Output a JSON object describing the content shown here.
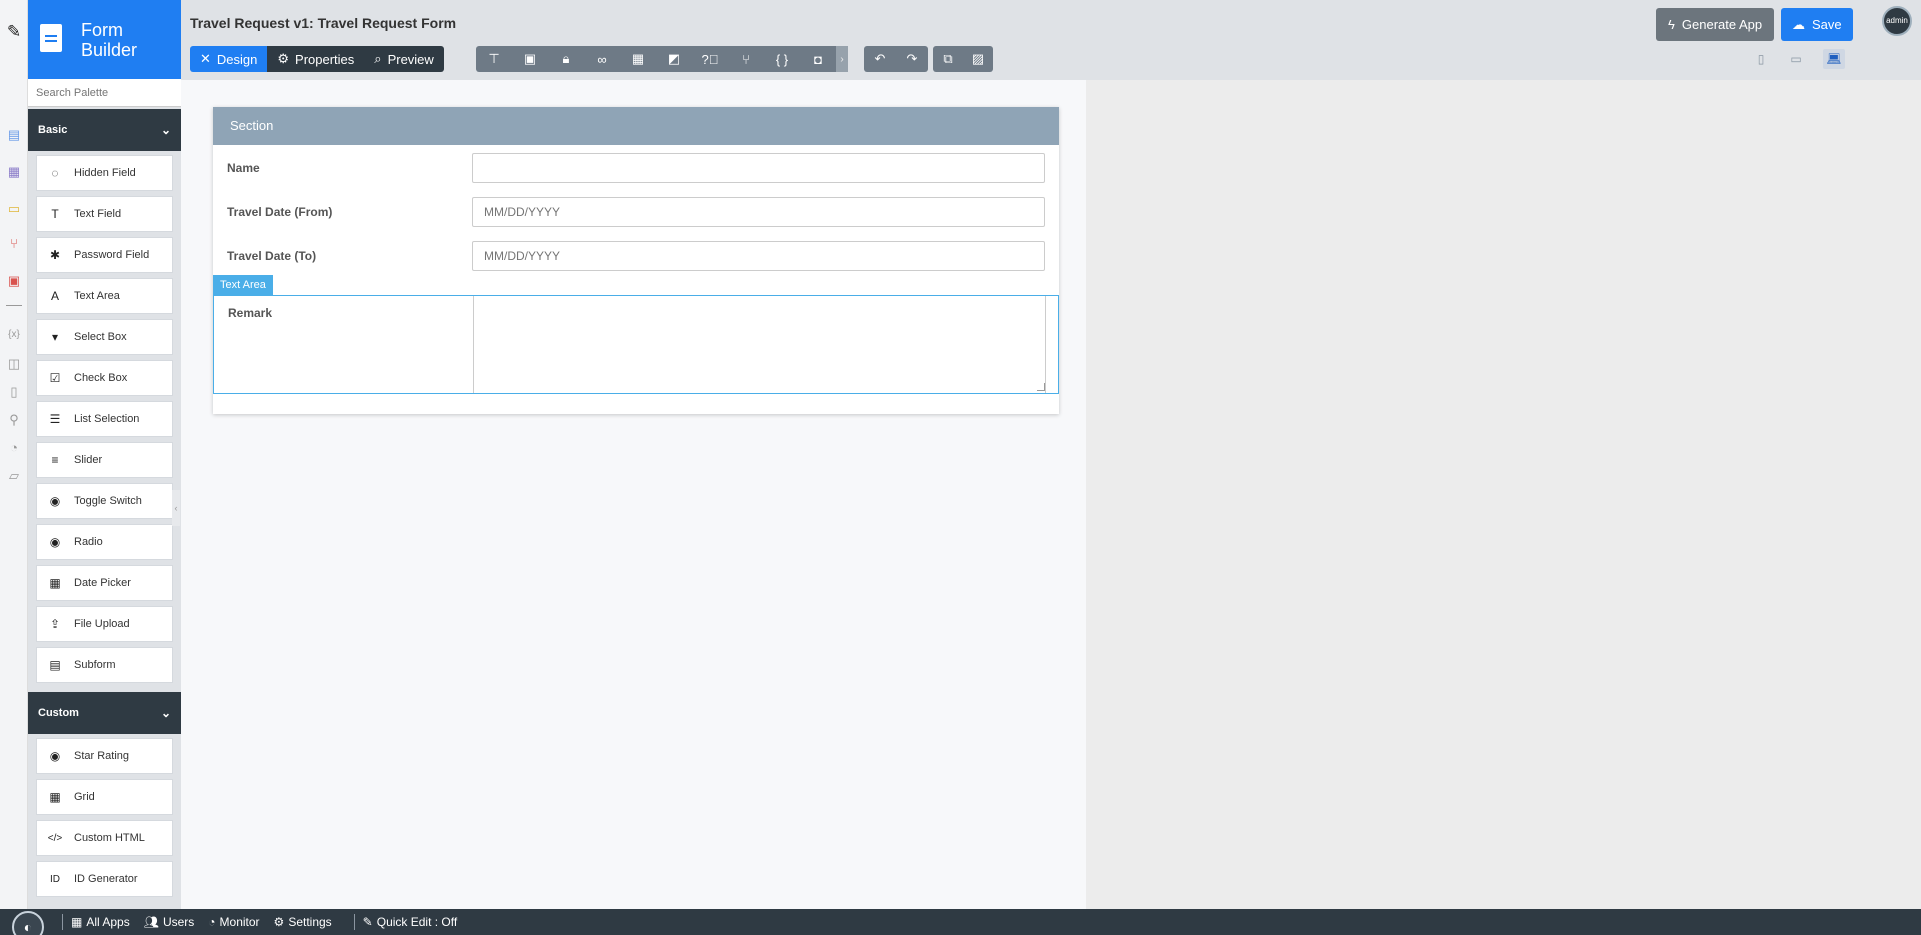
{
  "app": {
    "brand_title": "Form Builder",
    "page_title": "Travel Request v1: Travel Request Form"
  },
  "palette": {
    "search_placeholder": "Search Palette",
    "categories": [
      {
        "label": "Basic",
        "items": [
          {
            "label": "Hidden Field",
            "icon": "eye-slash-icon"
          },
          {
            "label": "Text Field",
            "icon": "text-field-icon"
          },
          {
            "label": "Password Field",
            "icon": "asterisk-icon"
          },
          {
            "label": "Text Area",
            "icon": "text-area-icon"
          },
          {
            "label": "Select Box",
            "icon": "select-box-icon"
          },
          {
            "label": "Check Box",
            "icon": "check-box-icon"
          },
          {
            "label": "List Selection",
            "icon": "list-icon"
          },
          {
            "label": "Slider",
            "icon": "sliders-icon"
          },
          {
            "label": "Toggle Switch",
            "icon": "toggle-icon"
          },
          {
            "label": "Radio",
            "icon": "radio-icon"
          },
          {
            "label": "Date Picker",
            "icon": "calendar-icon"
          },
          {
            "label": "File Upload",
            "icon": "upload-icon"
          },
          {
            "label": "Subform",
            "icon": "subform-icon"
          }
        ]
      },
      {
        "label": "Custom",
        "items": [
          {
            "label": "Star Rating",
            "icon": "star-rating-icon"
          },
          {
            "label": "Grid",
            "icon": "grid-icon"
          },
          {
            "label": "Custom HTML",
            "icon": "code-icon"
          },
          {
            "label": "ID Generator",
            "icon": "id-icon"
          }
        ]
      }
    ]
  },
  "toolbar": {
    "modes": [
      {
        "label": "Design",
        "icon": "design-icon",
        "active": true
      },
      {
        "label": "Properties",
        "icon": "gear-icon",
        "active": false
      },
      {
        "label": "Preview",
        "icon": "preview-icon",
        "active": false
      }
    ],
    "tools": [
      "tree-icon",
      "form-icon",
      "lock-icon",
      "binoculars-icon",
      "table-icon",
      "translate-icon",
      "help-icon",
      "branch-icon",
      "braces-icon",
      "camera-icon"
    ],
    "generate_label": "Generate App",
    "save_label": "Save",
    "avatar_label": "admin"
  },
  "form": {
    "section_label": "Section",
    "fields": [
      {
        "label": "Name",
        "value": "",
        "placeholder": ""
      },
      {
        "label": "Travel Date (From)",
        "value": "",
        "placeholder": "MM/DD/YYYY"
      },
      {
        "label": "Travel Date (To)",
        "value": "",
        "placeholder": "MM/DD/YYYY"
      }
    ],
    "textarea": {
      "badge": "Text Area",
      "label": "Remark",
      "value": ""
    }
  },
  "bottombar": {
    "all_apps": "All Apps",
    "users": "Users",
    "monitor": "Monitor",
    "settings": "Settings",
    "quick_edit": "Quick Edit : Off"
  }
}
